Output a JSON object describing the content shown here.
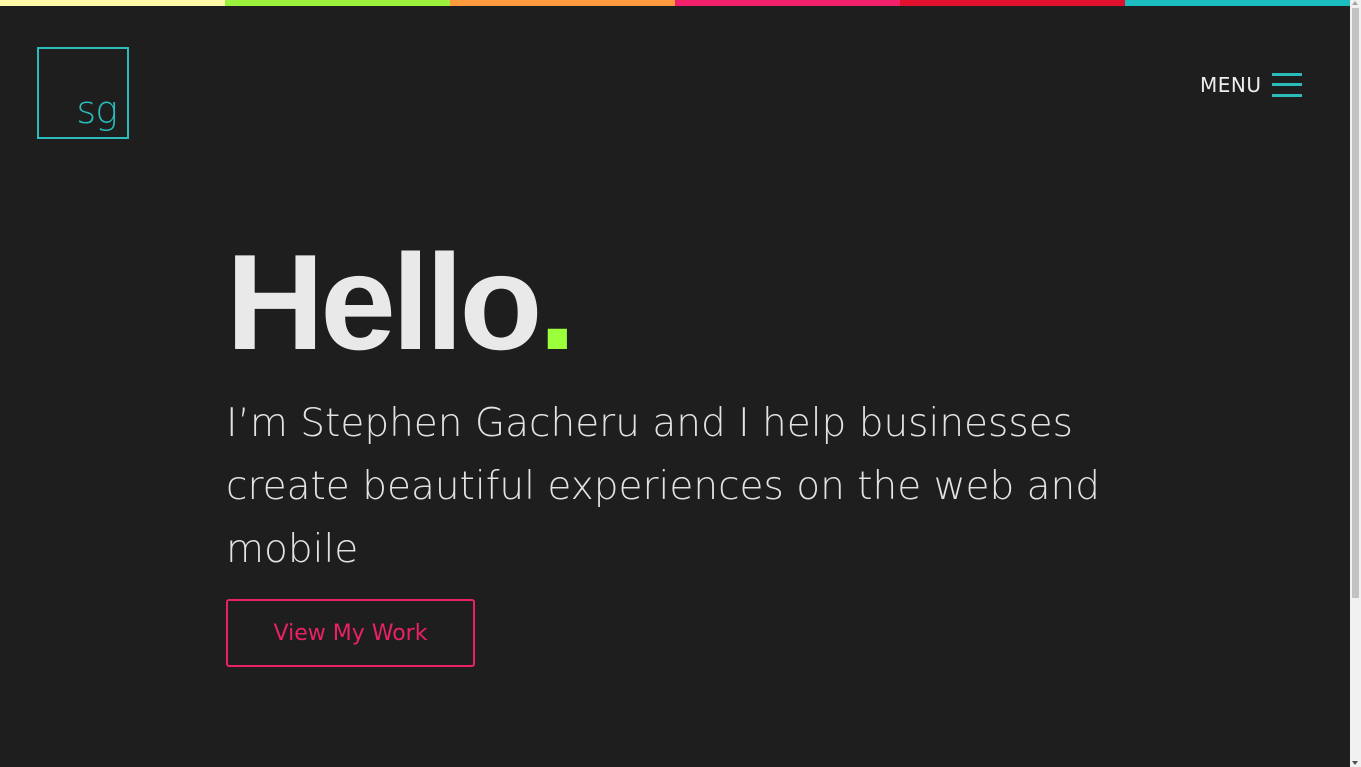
{
  "top_bar": {
    "colors": [
      "#fff9a8",
      "#9bf23c",
      "#ff9a3d",
      "#f2206a",
      "#e0102e",
      "#1bbdbe"
    ]
  },
  "logo": {
    "text": "sg",
    "color": "#2bbbbb"
  },
  "nav": {
    "menu_label": "MENU",
    "menu_icon": "hamburger-icon"
  },
  "hero": {
    "heading": "Hello",
    "heading_dot": ".",
    "intro": "I’m Stephen Gacheru and I help businesses create beautiful experiences on the web and mobile",
    "cta_label": "View My Work"
  },
  "colors": {
    "background": "#1e1e1e",
    "accent_teal": "#2bbbbb",
    "accent_green": "#9bff3c",
    "accent_pink": "#ea2163",
    "text": "#e9e9e9"
  }
}
